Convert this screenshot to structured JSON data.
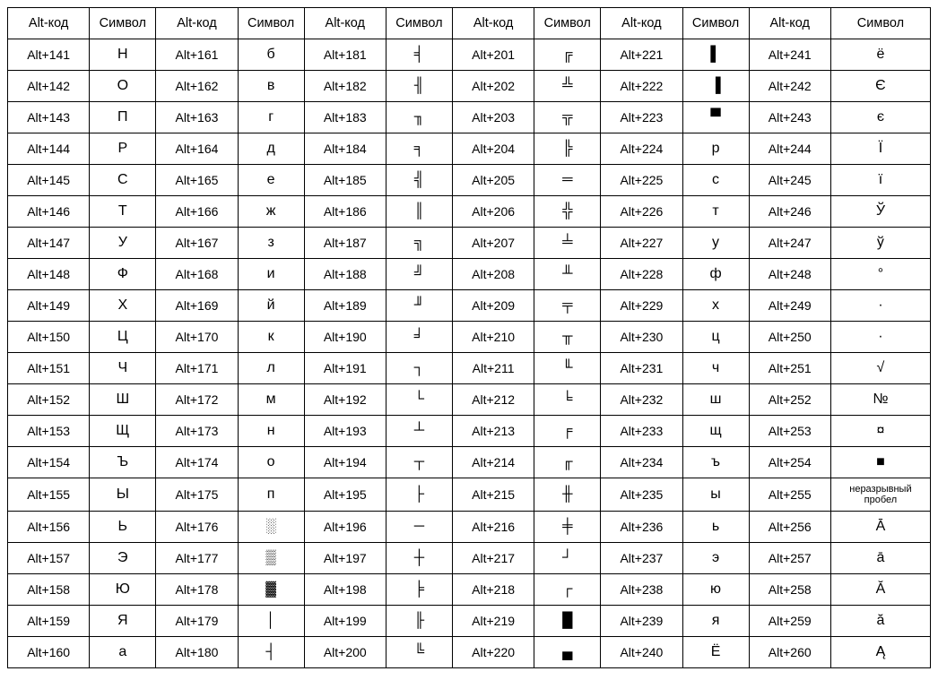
{
  "headers": {
    "alt": "Alt-код",
    "sym": "Символ"
  },
  "column_count": 6,
  "smallSymbols": [
    "неразрывный пробел"
  ],
  "columns": [
    [
      {
        "code": "Alt+141",
        "sym": "Н"
      },
      {
        "code": "Alt+142",
        "sym": "О"
      },
      {
        "code": "Alt+143",
        "sym": "П"
      },
      {
        "code": "Alt+144",
        "sym": "Р"
      },
      {
        "code": "Alt+145",
        "sym": "С"
      },
      {
        "code": "Alt+146",
        "sym": "Т"
      },
      {
        "code": "Alt+147",
        "sym": "У"
      },
      {
        "code": "Alt+148",
        "sym": "Ф"
      },
      {
        "code": "Alt+149",
        "sym": "Х"
      },
      {
        "code": "Alt+150",
        "sym": "Ц"
      },
      {
        "code": "Alt+151",
        "sym": "Ч"
      },
      {
        "code": "Alt+152",
        "sym": "Ш"
      },
      {
        "code": "Alt+153",
        "sym": "Щ"
      },
      {
        "code": "Alt+154",
        "sym": "Ъ"
      },
      {
        "code": "Alt+155",
        "sym": "Ы"
      },
      {
        "code": "Alt+156",
        "sym": "Ь"
      },
      {
        "code": "Alt+157",
        "sym": "Э"
      },
      {
        "code": "Alt+158",
        "sym": "Ю"
      },
      {
        "code": "Alt+159",
        "sym": "Я"
      },
      {
        "code": "Alt+160",
        "sym": "а"
      }
    ],
    [
      {
        "code": "Alt+161",
        "sym": "б"
      },
      {
        "code": "Alt+162",
        "sym": "в"
      },
      {
        "code": "Alt+163",
        "sym": "г"
      },
      {
        "code": "Alt+164",
        "sym": "д"
      },
      {
        "code": "Alt+165",
        "sym": "е"
      },
      {
        "code": "Alt+166",
        "sym": "ж"
      },
      {
        "code": "Alt+167",
        "sym": "з"
      },
      {
        "code": "Alt+168",
        "sym": "и"
      },
      {
        "code": "Alt+169",
        "sym": "й"
      },
      {
        "code": "Alt+170",
        "sym": "к"
      },
      {
        "code": "Alt+171",
        "sym": "л"
      },
      {
        "code": "Alt+172",
        "sym": "м"
      },
      {
        "code": "Alt+173",
        "sym": "н"
      },
      {
        "code": "Alt+174",
        "sym": "о"
      },
      {
        "code": "Alt+175",
        "sym": "п"
      },
      {
        "code": "Alt+176",
        "sym": "░"
      },
      {
        "code": "Alt+177",
        "sym": "▒"
      },
      {
        "code": "Alt+178",
        "sym": "▓"
      },
      {
        "code": "Alt+179",
        "sym": "│"
      },
      {
        "code": "Alt+180",
        "sym": "┤"
      }
    ],
    [
      {
        "code": "Alt+181",
        "sym": "╡"
      },
      {
        "code": "Alt+182",
        "sym": "╢"
      },
      {
        "code": "Alt+183",
        "sym": "╖"
      },
      {
        "code": "Alt+184",
        "sym": "╕"
      },
      {
        "code": "Alt+185",
        "sym": "╣"
      },
      {
        "code": "Alt+186",
        "sym": "║"
      },
      {
        "code": "Alt+187",
        "sym": "╗"
      },
      {
        "code": "Alt+188",
        "sym": "╝"
      },
      {
        "code": "Alt+189",
        "sym": "╜"
      },
      {
        "code": "Alt+190",
        "sym": "╛"
      },
      {
        "code": "Alt+191",
        "sym": "┐"
      },
      {
        "code": "Alt+192",
        "sym": "└"
      },
      {
        "code": "Alt+193",
        "sym": "┴"
      },
      {
        "code": "Alt+194",
        "sym": "┬"
      },
      {
        "code": "Alt+195",
        "sym": "├"
      },
      {
        "code": "Alt+196",
        "sym": "─"
      },
      {
        "code": "Alt+197",
        "sym": "┼"
      },
      {
        "code": "Alt+198",
        "sym": "╞"
      },
      {
        "code": "Alt+199",
        "sym": "╟"
      },
      {
        "code": "Alt+200",
        "sym": "╚"
      }
    ],
    [
      {
        "code": "Alt+201",
        "sym": "╔"
      },
      {
        "code": "Alt+202",
        "sym": "╩"
      },
      {
        "code": "Alt+203",
        "sym": "╦"
      },
      {
        "code": "Alt+204",
        "sym": "╠"
      },
      {
        "code": "Alt+205",
        "sym": "═"
      },
      {
        "code": "Alt+206",
        "sym": "╬"
      },
      {
        "code": "Alt+207",
        "sym": "╧"
      },
      {
        "code": "Alt+208",
        "sym": "╨"
      },
      {
        "code": "Alt+209",
        "sym": "╤"
      },
      {
        "code": "Alt+210",
        "sym": "╥"
      },
      {
        "code": "Alt+211",
        "sym": "╙"
      },
      {
        "code": "Alt+212",
        "sym": "╘"
      },
      {
        "code": "Alt+213",
        "sym": "╒"
      },
      {
        "code": "Alt+214",
        "sym": "╓"
      },
      {
        "code": "Alt+215",
        "sym": "╫"
      },
      {
        "code": "Alt+216",
        "sym": "╪"
      },
      {
        "code": "Alt+217",
        "sym": "┘"
      },
      {
        "code": "Alt+218",
        "sym": "┌"
      },
      {
        "code": "Alt+219",
        "sym": "█"
      },
      {
        "code": "Alt+220",
        "sym": "▄"
      }
    ],
    [
      {
        "code": "Alt+221",
        "sym": "▌"
      },
      {
        "code": "Alt+222",
        "sym": "▐"
      },
      {
        "code": "Alt+223",
        "sym": "▀"
      },
      {
        "code": "Alt+224",
        "sym": "р"
      },
      {
        "code": "Alt+225",
        "sym": "с"
      },
      {
        "code": "Alt+226",
        "sym": "т"
      },
      {
        "code": "Alt+227",
        "sym": "у"
      },
      {
        "code": "Alt+228",
        "sym": "ф"
      },
      {
        "code": "Alt+229",
        "sym": "х"
      },
      {
        "code": "Alt+230",
        "sym": "ц"
      },
      {
        "code": "Alt+231",
        "sym": "ч"
      },
      {
        "code": "Alt+232",
        "sym": "ш"
      },
      {
        "code": "Alt+233",
        "sym": "щ"
      },
      {
        "code": "Alt+234",
        "sym": "ъ"
      },
      {
        "code": "Alt+235",
        "sym": "ы"
      },
      {
        "code": "Alt+236",
        "sym": "ь"
      },
      {
        "code": "Alt+237",
        "sym": "э"
      },
      {
        "code": "Alt+238",
        "sym": "ю"
      },
      {
        "code": "Alt+239",
        "sym": "я"
      },
      {
        "code": "Alt+240",
        "sym": "Ё"
      }
    ],
    [
      {
        "code": "Alt+241",
        "sym": "ё"
      },
      {
        "code": "Alt+242",
        "sym": "Є"
      },
      {
        "code": "Alt+243",
        "sym": "є"
      },
      {
        "code": "Alt+244",
        "sym": "Ї"
      },
      {
        "code": "Alt+245",
        "sym": "ї"
      },
      {
        "code": "Alt+246",
        "sym": "Ў"
      },
      {
        "code": "Alt+247",
        "sym": "ў"
      },
      {
        "code": "Alt+248",
        "sym": "°"
      },
      {
        "code": "Alt+249",
        "sym": "∙"
      },
      {
        "code": "Alt+250",
        "sym": "·"
      },
      {
        "code": "Alt+251",
        "sym": "√"
      },
      {
        "code": "Alt+252",
        "sym": "№"
      },
      {
        "code": "Alt+253",
        "sym": "¤"
      },
      {
        "code": "Alt+254",
        "sym": "■"
      },
      {
        "code": "Alt+255",
        "sym": "неразрывный пробел"
      },
      {
        "code": "Alt+256",
        "sym": "Ā"
      },
      {
        "code": "Alt+257",
        "sym": "ā"
      },
      {
        "code": "Alt+258",
        "sym": "Ă"
      },
      {
        "code": "Alt+259",
        "sym": "ă"
      },
      {
        "code": "Alt+260",
        "sym": "Ą"
      }
    ]
  ]
}
